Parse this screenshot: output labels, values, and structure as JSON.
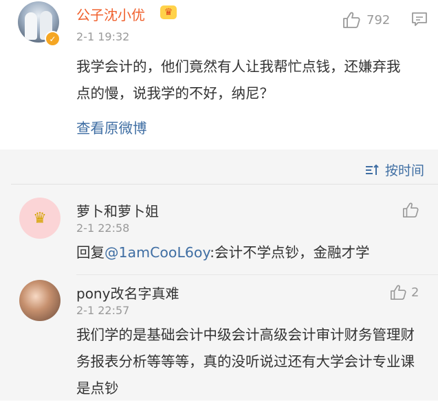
{
  "post": {
    "author": "公子沈小优",
    "timestamp": "2-1 19:32",
    "like_count": "792",
    "content": "我学会计的，他们竟然有人让我帮忙点钱，还嫌弃我点的慢，说我学的不好，纳尼？",
    "view_original": "查看原微博"
  },
  "comments_section": {
    "sort_label": "按时间",
    "items": [
      {
        "author": "萝卜和萝卜姐",
        "timestamp": "2-1 22:58",
        "like_count": "",
        "reply_prefix": "回复",
        "mention": "@1amCooL6oy",
        "text": ":会计不学点钞，金融才学"
      },
      {
        "author": "pony改名字真难",
        "timestamp": "2-1 22:57",
        "like_count": "2",
        "text": "我们学的是基础会计中级会计高级会计审计财务管理财务报表分析等等等，真的没听说过还有大学会计专业课是点钞"
      }
    ]
  },
  "colors": {
    "username": "#f0612e",
    "link": "#3f6ea3",
    "muted": "#999999",
    "background_comments": "#f5f5f5"
  },
  "icons": {
    "like": "thumbs-up-icon",
    "comment": "comment-icon",
    "sort": "sort-icon",
    "verified": "verified-badge-icon",
    "crown": "crown-icon"
  }
}
